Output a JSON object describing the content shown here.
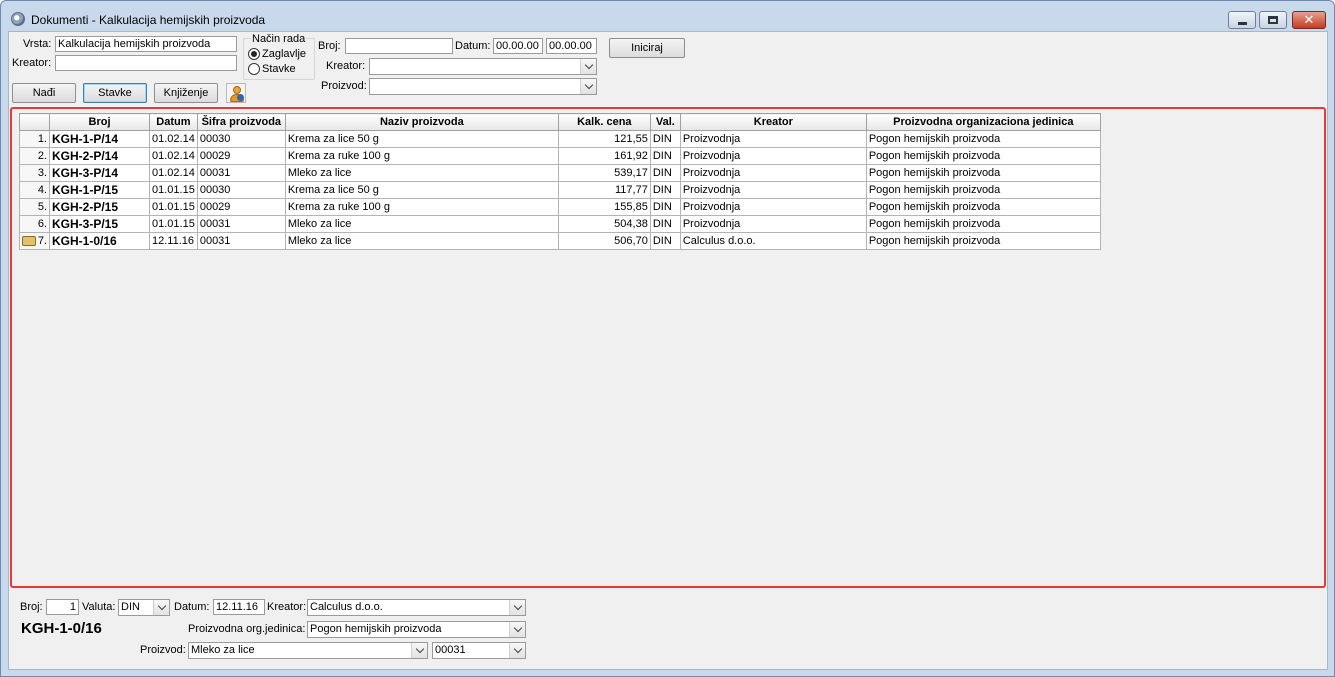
{
  "window": {
    "title": "Dokumenti - Kalkulacija hemijskih proizvoda",
    "controls": {
      "minimize": "",
      "maximize": "",
      "close": "✕"
    }
  },
  "filters": {
    "vrsta_label": "Vrsta:",
    "vrsta_value": "Kalkulacija hemijskih proizvoda",
    "kreator_label": "Kreator:",
    "kreator_value": "",
    "nacin_rada_label": "Način rada",
    "mode_header_label": "Zaglavlje",
    "mode_items_label": "Stavke",
    "mode_selected": "Zaglavlje",
    "broj_label": "Broj:",
    "broj_value": "",
    "datum_label": "Datum:",
    "datum_from": "00.00.00",
    "datum_to": "00.00.00",
    "kreator2_label": "Kreator:",
    "kreator2_value": "",
    "proizvod_label": "Proizvod:",
    "proizvod_value": "",
    "iniciraj_label": "Iniciraj"
  },
  "toolbar": {
    "find_label": "Nađi",
    "items_label": "Stavke",
    "posting_label": "Knjiženje"
  },
  "grid": {
    "columns": [
      "",
      "Broj",
      "Datum",
      "Šifra proizvoda",
      "Naziv proizvoda",
      "Kalk. cena",
      "Val.",
      "Kreator",
      "Proizvodna organizaciona jedinica"
    ],
    "rows": [
      {
        "n": "1.",
        "broj": "KGH-1-P/14",
        "datum": "01.02.14",
        "sifra": "00030",
        "naziv": "Krema za lice 50 g",
        "cena": "121,55",
        "val": "DIN",
        "kreator": "Proizvodnja",
        "org": "Pogon hemijskih proizvoda"
      },
      {
        "n": "2.",
        "broj": "KGH-2-P/14",
        "datum": "01.02.14",
        "sifra": "00029",
        "naziv": "Krema za ruke 100 g",
        "cena": "161,92",
        "val": "DIN",
        "kreator": "Proizvodnja",
        "org": "Pogon hemijskih proizvoda"
      },
      {
        "n": "3.",
        "broj": "KGH-3-P/14",
        "datum": "01.02.14",
        "sifra": "00031",
        "naziv": "Mleko za lice",
        "cena": "539,17",
        "val": "DIN",
        "kreator": "Proizvodnja",
        "org": "Pogon hemijskih proizvoda"
      },
      {
        "n": "4.",
        "broj": "KGH-1-P/15",
        "datum": "01.01.15",
        "sifra": "00030",
        "naziv": "Krema za lice 50 g",
        "cena": "117,77",
        "val": "DIN",
        "kreator": "Proizvodnja",
        "org": "Pogon hemijskih proizvoda"
      },
      {
        "n": "5.",
        "broj": "KGH-2-P/15",
        "datum": "01.01.15",
        "sifra": "00029",
        "naziv": "Krema za ruke 100 g",
        "cena": "155,85",
        "val": "DIN",
        "kreator": "Proizvodnja",
        "org": "Pogon hemijskih proizvoda"
      },
      {
        "n": "6.",
        "broj": "KGH-3-P/15",
        "datum": "01.01.15",
        "sifra": "00031",
        "naziv": "Mleko za lice",
        "cena": "504,38",
        "val": "DIN",
        "kreator": "Proizvodnja",
        "org": "Pogon hemijskih proizvoda"
      },
      {
        "n": "7.",
        "broj": "KGH-1-0/16",
        "datum": "12.11.16",
        "sifra": "00031",
        "naziv": "Mleko za lice",
        "cena": "506,70",
        "val": "DIN",
        "kreator": "Calculus d.o.o.",
        "org": "Pogon hemijskih proizvoda"
      }
    ]
  },
  "detail": {
    "broj_label": "Broj:",
    "broj_value": "1",
    "valuta_label": "Valuta:",
    "valuta_value": "DIN",
    "datum_label": "Datum:",
    "datum_value": "12.11.16",
    "kreator_label": "Kreator:",
    "kreator_value": "Calculus d.o.o.",
    "doc_number": "KGH-1-0/16",
    "org_label": "Proizvodna org.jedinica:",
    "org_value": "Pogon hemijskih proizvoda",
    "proizvod_label": "Proizvod:",
    "proizvod_value": "Mleko za lice",
    "proizvod_code": "00031"
  }
}
